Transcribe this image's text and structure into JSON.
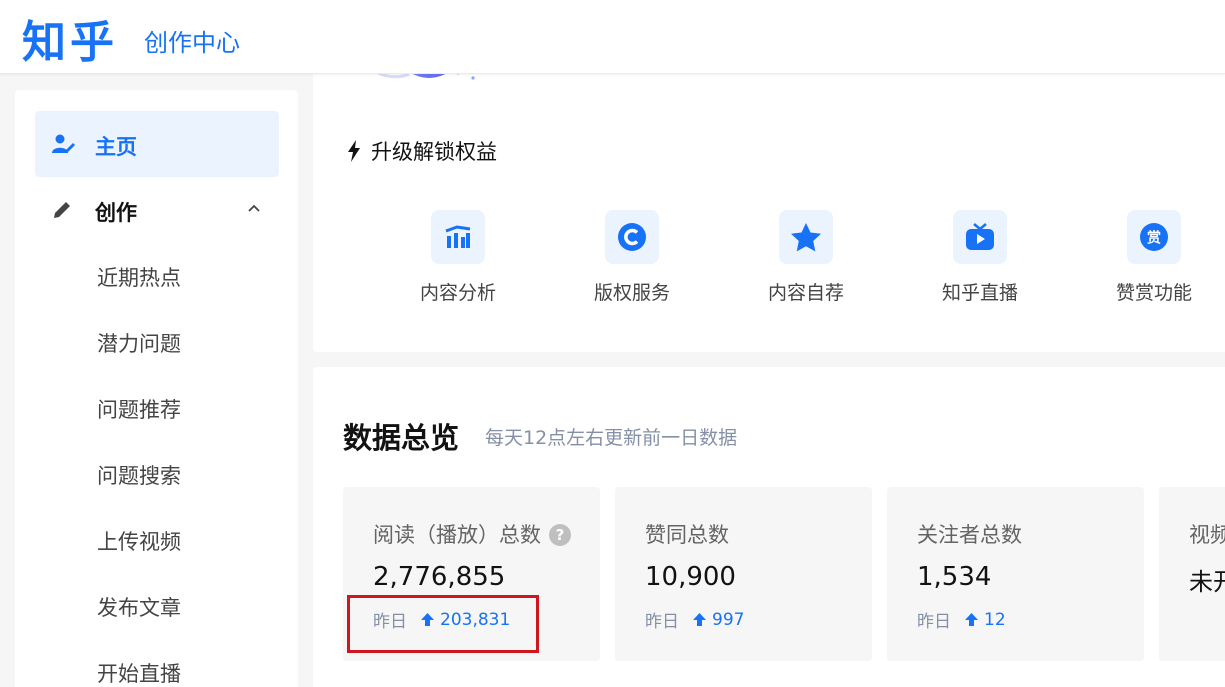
{
  "header": {
    "logo": "知乎",
    "subtitle": "创作中心"
  },
  "sidebar": {
    "items": [
      {
        "label": "主页",
        "icon": "user-icon"
      },
      {
        "label": "创作",
        "icon": "pencil-icon"
      }
    ],
    "sub_items": [
      "近期热点",
      "潜力问题",
      "问题推荐",
      "问题搜索",
      "上传视频",
      "发布文章",
      "开始直播"
    ]
  },
  "upgrade": {
    "label": "升级解锁权益"
  },
  "tools": [
    {
      "label": "内容分析",
      "icon": "chart-icon"
    },
    {
      "label": "版权服务",
      "icon": "copyright-icon"
    },
    {
      "label": "内容自荐",
      "icon": "star-icon"
    },
    {
      "label": "知乎直播",
      "icon": "tv-icon"
    },
    {
      "label": "赞赏功能",
      "icon": "reward-icon"
    }
  ],
  "overview": {
    "title": "数据总览",
    "hint": "每天12点左右更新前一日数据",
    "help_glyph": "?",
    "reward_glyph": "赏",
    "stats": [
      {
        "label": "阅读（播放）总数",
        "value": "2,776,855",
        "yday_label": "昨日",
        "yday_value": "203,831"
      },
      {
        "label": "赞同总数",
        "value": "10,900",
        "yday_label": "昨日",
        "yday_value": "997"
      },
      {
        "label": "关注者总数",
        "value": "1,534",
        "yday_label": "昨日",
        "yday_value": "12"
      },
      {
        "label": "视频",
        "value": "未开"
      }
    ]
  },
  "colors": {
    "brand": "#1772f6",
    "highlight_box": "#d0171f"
  }
}
